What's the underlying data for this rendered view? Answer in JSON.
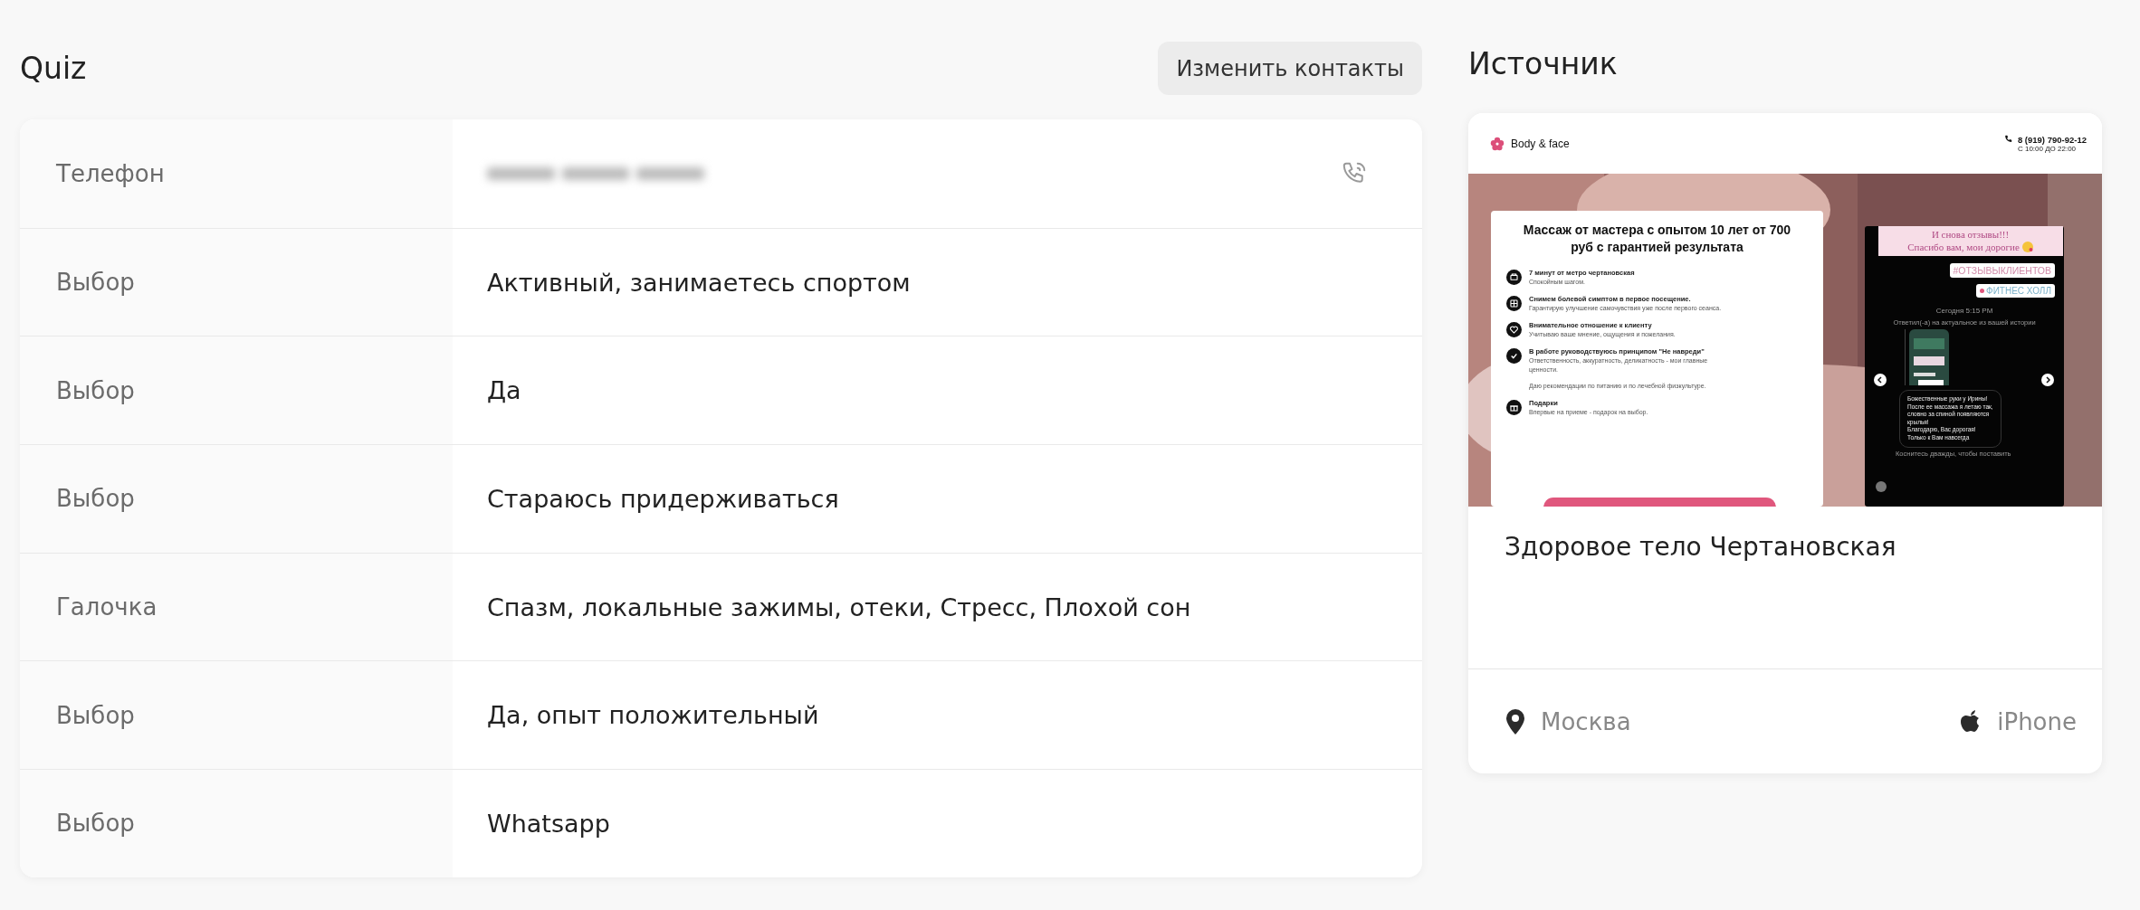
{
  "quiz": {
    "title": "Quiz",
    "edit_button": "Изменить контакты",
    "rows": [
      {
        "kind": "phone",
        "label": "Телефон"
      },
      {
        "kind": "text",
        "label": "Выбор",
        "value": "Активный, занимаетесь спортом"
      },
      {
        "kind": "text",
        "label": "Выбор",
        "value": "Да"
      },
      {
        "kind": "text",
        "label": "Выбор",
        "value": "Стараюсь придерживаться"
      },
      {
        "kind": "text",
        "label": "Галочка",
        "value": "Спазм, локальные зажимы, отеки, Стресс, Плохой сон"
      },
      {
        "kind": "text",
        "label": "Выбор",
        "value": "Да, опыт положительный"
      },
      {
        "kind": "text",
        "label": "Выбор",
        "value": "Whatsapp"
      }
    ]
  },
  "source": {
    "title": "Источник",
    "preview": {
      "logo": "Body & face",
      "phone": "8 (919) 790-92-12",
      "hours": "С 10:00 ДО 22:00",
      "headline": "Массаж от мастера с опытом 10 лет от 700 руб с гарантией результата",
      "features": [
        {
          "title": "7 минут от метро чертановская",
          "text": "Спокойным шагом."
        },
        {
          "title": "Снимем болевой симптом в первое посещение.",
          "text": "Гарантирую улучшение самочувствия уже после первого сеанса."
        },
        {
          "title": "Внимательное отношение к клиенту",
          "text": "Учитываю ваше мнение, ощущения и пожелания."
        },
        {
          "title": "В работе руководствуюсь принципом \"Не навреди\"",
          "text": "Ответственность, аккуратность, деликатность - мои главные ценности.",
          "note": "Даю рекомендации по питанию и по лечебной физкультуре."
        },
        {
          "title": "Подарки",
          "text": "Впервые на приеме - подарок на выбор."
        }
      ],
      "story": {
        "caption_lines": [
          "И снова отзывы!!!",
          "Спасибо вам, мои дорогие"
        ],
        "hashtag": "#ОТЗЫВЫКЛИЕНТОВ",
        "location": "ФИТНЕС ХОЛЛ",
        "time": "Сегодня 5:15 PM",
        "reply_note": "Ответил(-а) на актуальное из вашей истории",
        "message_lines": [
          "Божественные руки у Ирины!",
          "После ее массажа я летаю так,",
          "словно за спиной появляются",
          "крылья!",
          "Благодарю, Вас дорогая!",
          "Только к Вам навсегда"
        ],
        "hint": "Коснитесь дважды, чтобы поставить"
      }
    },
    "name": "Здоровое тело Чертановская",
    "city": "Москва",
    "device": "iPhone"
  }
}
